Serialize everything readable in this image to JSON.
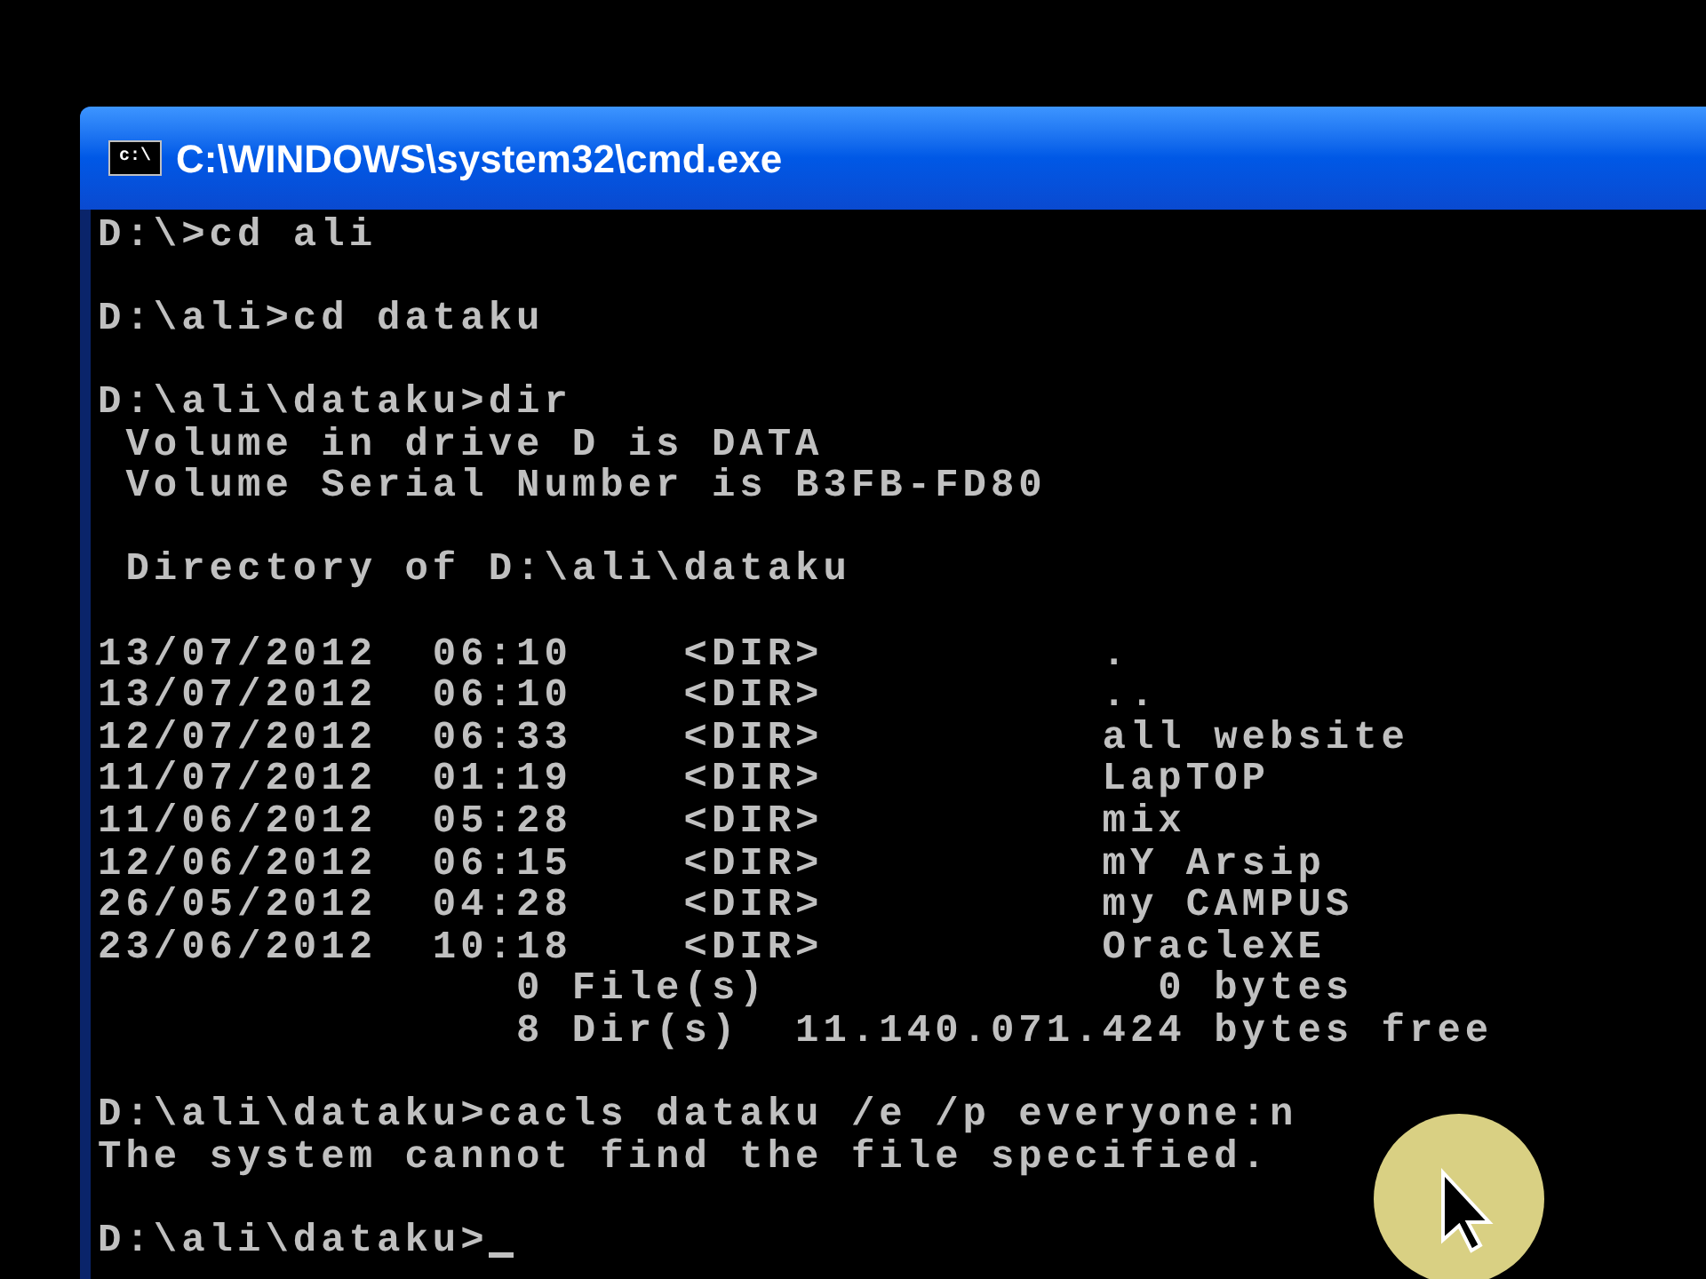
{
  "window": {
    "icon_text": "c:\\",
    "title": "C:\\WINDOWS\\system32\\cmd.exe"
  },
  "console": {
    "blocks": [
      [
        "D:\\>cd ali"
      ],
      [
        "D:\\ali>cd dataku"
      ],
      [
        "D:\\ali\\dataku>dir",
        " Volume in drive D is DATA",
        " Volume Serial Number is B3FB-FD80"
      ],
      [
        " Directory of D:\\ali\\dataku"
      ],
      [
        "13/07/2012  06:10    <DIR>          .",
        "13/07/2012  06:10    <DIR>          ..",
        "12/07/2012  06:33    <DIR>          all website",
        "11/07/2012  01:19    <DIR>          LapTOP",
        "11/06/2012  05:28    <DIR>          mix",
        "12/06/2012  06:15    <DIR>          mY Arsip",
        "26/05/2012  04:28    <DIR>          my CAMPUS",
        "23/06/2012  10:18    <DIR>          OracleXE",
        "               0 File(s)              0 bytes",
        "               8 Dir(s)  11.140.071.424 bytes free"
      ],
      [
        "D:\\ali\\dataku>cacls dataku /e /p everyone:n",
        "The system cannot find the file specified."
      ],
      [
        "D:\\ali\\dataku>"
      ]
    ],
    "cursor_visible": true
  }
}
